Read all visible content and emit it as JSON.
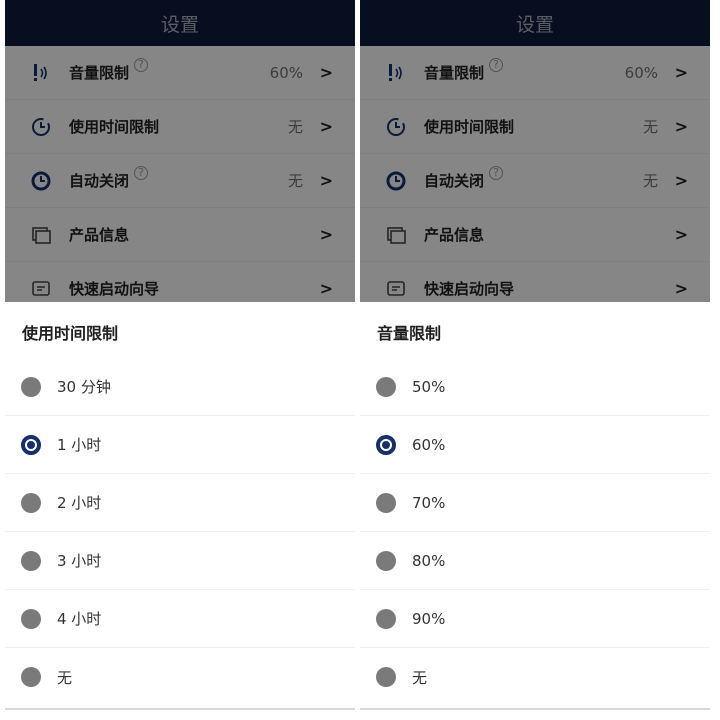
{
  "screens": [
    {
      "nav_title": "设置",
      "settings": [
        {
          "label": "音量限制",
          "help": "?",
          "value": "60%",
          "chevron": ">",
          "icon": "volume-limit-icon"
        },
        {
          "label": "使用时间限制",
          "help": "",
          "value": "无",
          "chevron": ">",
          "icon": "timer-limit-icon"
        },
        {
          "label": "自动关闭",
          "help": "?",
          "value": "无",
          "chevron": ">",
          "icon": "auto-off-icon"
        },
        {
          "label": "产品信息",
          "help": "",
          "value": "",
          "chevron": ">",
          "icon": "product-info-icon"
        },
        {
          "label": "快速启动向导",
          "help": "",
          "value": "",
          "chevron": ">",
          "icon": "quick-start-icon"
        }
      ],
      "sheet": {
        "title": "使用时间限制",
        "options": [
          "30 分钟",
          "1 小时",
          "2 小时",
          "3 小时",
          "4 小时",
          "无"
        ],
        "selected_index": 1
      }
    },
    {
      "nav_title": "设置",
      "settings": [
        {
          "label": "音量限制",
          "help": "?",
          "value": "60%",
          "chevron": ">",
          "icon": "volume-limit-icon"
        },
        {
          "label": "使用时间限制",
          "help": "",
          "value": "无",
          "chevron": ">",
          "icon": "timer-limit-icon"
        },
        {
          "label": "自动关闭",
          "help": "?",
          "value": "无",
          "chevron": ">",
          "icon": "auto-off-icon"
        },
        {
          "label": "产品信息",
          "help": "",
          "value": "",
          "chevron": ">",
          "icon": "product-info-icon"
        },
        {
          "label": "快速启动向导",
          "help": "",
          "value": "",
          "chevron": ">",
          "icon": "quick-start-icon"
        }
      ],
      "sheet": {
        "title": "音量限制",
        "options": [
          "50%",
          "60%",
          "70%",
          "80%",
          "90%",
          "无"
        ],
        "selected_index": 1
      }
    }
  ],
  "colors": {
    "navbar": "#0c1a3a",
    "accent_radio": "#17306b",
    "unselected_radio": "#7a7a7a"
  }
}
